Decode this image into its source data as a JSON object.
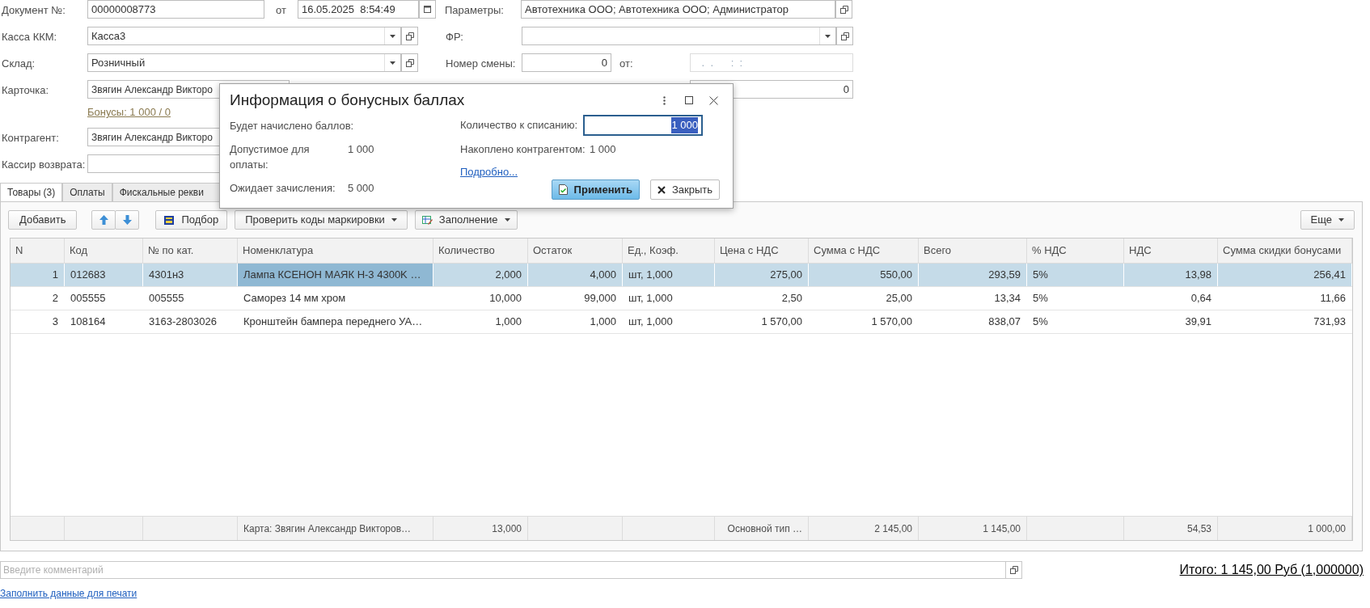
{
  "form": {
    "doc_number": {
      "label": "Документ №:",
      "value": "00000008773"
    },
    "date": {
      "label": "от",
      "value": "16.05.2025  8:54:49"
    },
    "params": {
      "label": "Параметры:",
      "value": "Автотехника ООО; Автотехника ООО; Администратор"
    },
    "kkm": {
      "label": "Касса ККМ:",
      "value": "Касса3"
    },
    "fr": {
      "label": "ФР:"
    },
    "warehouse": {
      "label": "Склад:",
      "value": "Розничный"
    },
    "shift": {
      "label": "Номер  смены:",
      "value": "0"
    },
    "shift_date": {
      "label": "от:",
      "value": " .  .      :  :"
    },
    "card": {
      "label": "Карточка:",
      "value": "Звягин Александр Викторо"
    },
    "field_4": {
      "value": "0"
    },
    "bonus_link": "Бонусы: 1 000 / 0",
    "counterparty": {
      "label": "Контрагент:",
      "value": "Звягин Александр Викторо"
    },
    "cashier": {
      "label": "Кассир возврата:"
    }
  },
  "tabs": [
    {
      "label": "Товары (3)",
      "selected": true
    },
    {
      "label": "Оплаты",
      "selected": false
    },
    {
      "label": "Фискальные рекви",
      "selected": false
    }
  ],
  "toolbar": {
    "add": "Добавить",
    "pick": "Подбор",
    "check": "Проверить коды маркировки",
    "fill": "Заполнение",
    "more": "Еще"
  },
  "table": {
    "columns": [
      {
        "label": "N",
        "current": false
      },
      {
        "label": "Код",
        "current": false
      },
      {
        "label": "№ по кат.",
        "current": false
      },
      {
        "label": "Номенклатура",
        "current": true
      },
      {
        "label": "Количество",
        "current": false
      },
      {
        "label": "Остаток",
        "current": false
      },
      {
        "label": "Ед., Коэф.",
        "current": false
      },
      {
        "label": "Цена с НДС",
        "current": false
      },
      {
        "label": "Сумма с НДС",
        "current": false
      },
      {
        "label": "Всего",
        "current": false
      },
      {
        "label": "% НДС",
        "current": false
      },
      {
        "label": "НДС",
        "current": false
      },
      {
        "label": "Сумма скидки бонусами",
        "current": false
      }
    ],
    "rows": [
      {
        "selected": true,
        "cells": [
          "1",
          "012683",
          "4301н3",
          "Лампа КСЕНОН МАЯК Н-3 4300K …",
          "2,000",
          "4,000",
          "шт, 1,000",
          "275,00",
          "550,00",
          "293,59",
          "5%",
          "13,98",
          "256,41"
        ]
      },
      {
        "selected": false,
        "cells": [
          "2",
          "005555",
          "005555",
          "Саморез 14 мм хром",
          "10,000",
          "99,000",
          "шт, 1,000",
          "2,50",
          "25,00",
          "13,34",
          "5%",
          "0,64",
          "11,66"
        ]
      },
      {
        "selected": false,
        "cells": [
          "3",
          "108164",
          "3163-2803026",
          "Кронштейн бампера переднего УА…",
          "1,000",
          "1,000",
          "шт, 1,000",
          "1 570,00",
          "1 570,00",
          "838,07",
          "5%",
          "39,91",
          "731,93"
        ]
      }
    ],
    "footer": [
      {
        "kind": "empty"
      },
      {
        "kind": "empty"
      },
      {
        "kind": "empty"
      },
      {
        "kind": "text",
        "text": "Карта: Звягин Александр Викторов…"
      },
      {
        "kind": "text",
        "text": "13,000"
      },
      {
        "kind": "empty"
      },
      {
        "kind": "empty"
      },
      {
        "kind": "text",
        "text": "Основной тип …"
      },
      {
        "kind": "text",
        "text": "2 145,00"
      },
      {
        "kind": "text",
        "text": "1 145,00"
      },
      {
        "kind": "empty"
      },
      {
        "kind": "text",
        "text": "54,53"
      },
      {
        "kind": "text",
        "text": "1 000,00"
      }
    ]
  },
  "comment": {
    "placeholder": "Введите комментарий"
  },
  "total": "Итого: 1 145,00 Руб (1,000000)",
  "print_link": "Заполнить данные для печати",
  "dialog": {
    "title": "Информация о бонусных баллах",
    "accrue_label": "Будет начислено баллов:",
    "allowed_label": "Допустимое для оплаты:",
    "allowed_value": "1 000",
    "pending_label": "Ожидает зачисления:",
    "pending_value": "5 000",
    "writeoff_label": "Количество к списанию:",
    "writeoff_value": "1 000",
    "writeoff_selected": true,
    "accumulated_label": "Накоплено контрагентом:",
    "accumulated_value": "1 000",
    "details_link": "Подробно...",
    "apply": "Применить",
    "close": "Закрыть"
  }
}
